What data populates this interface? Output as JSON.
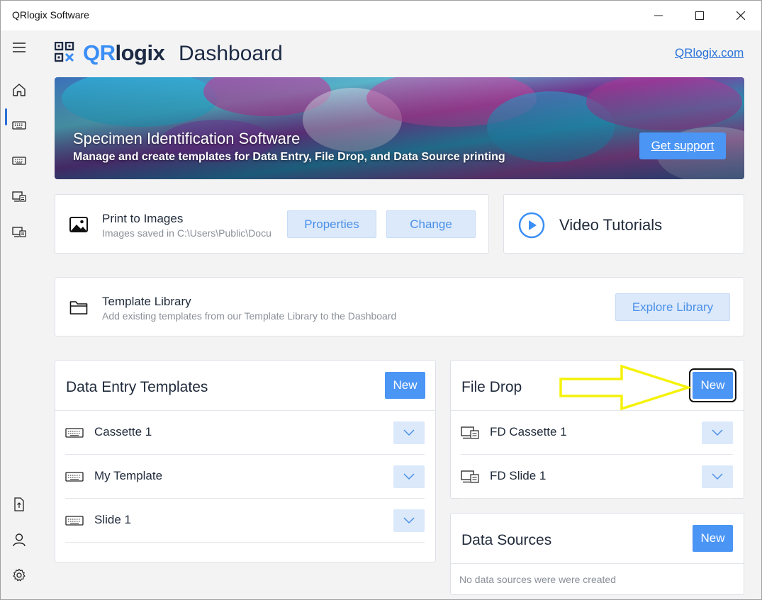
{
  "window": {
    "title": "QRlogix Software"
  },
  "header": {
    "brand_qr": "QR",
    "brand_logix": "logix",
    "title": "Dashboard",
    "link": "QRlogix.com"
  },
  "banner": {
    "title": "Specimen Identification Software",
    "subtitle": "Manage and create templates for Data Entry, File Drop, and Data Source printing",
    "button": "Get support"
  },
  "printer": {
    "title": "Print to Images",
    "subtitle": "Images saved in C:\\Users\\Public\\Docu",
    "properties_button": "Properties",
    "change_button": "Change"
  },
  "video": {
    "title": "Video Tutorials"
  },
  "library": {
    "title": "Template Library",
    "subtitle": "Add existing templates from our Template Library to the Dashboard",
    "button": "Explore Library"
  },
  "data_entry": {
    "title": "Data Entry Templates",
    "new_button": "New",
    "items": [
      {
        "label": "Cassette 1",
        "icon": "keyboard-icon"
      },
      {
        "label": "My Template",
        "icon": "keyboard-icon"
      },
      {
        "label": "Slide 1",
        "icon": "keyboard-icon"
      }
    ]
  },
  "file_drop": {
    "title": "File Drop",
    "new_button": "New",
    "items": [
      {
        "label": "FD Cassette 1",
        "icon": "monitor-drop-icon"
      },
      {
        "label": "FD Slide 1",
        "icon": "monitor-drop-icon"
      }
    ]
  },
  "data_sources": {
    "title": "Data Sources",
    "new_button": "New",
    "empty_text": "No data sources were were created"
  },
  "colors": {
    "accent": "#4b95f5",
    "light_button": "#dbe9fb",
    "annotation_arrow": "#f5f20a"
  }
}
